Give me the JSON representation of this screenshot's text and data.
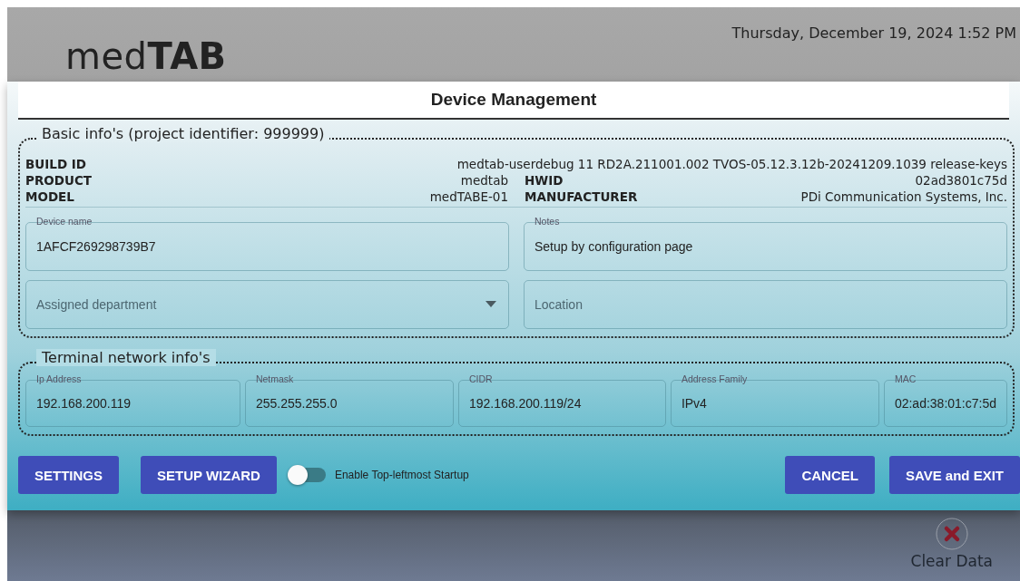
{
  "header": {
    "logo": {
      "light": "med",
      "bold": "TAB"
    },
    "datetime": "Thursday, December 19, 2024 1:52 PM"
  },
  "dialog": {
    "title": "Device Management",
    "basic_info": {
      "legend": "Basic info's (project identifier: 999999)",
      "build": {
        "label": "BUILD ID",
        "value": "medtab-userdebug 11 RD2A.211001.002 TVOS-05.12.3.12b-20241209.1039 release-keys"
      },
      "pairs": [
        [
          {
            "label": "PRODUCT",
            "value": "medtab"
          },
          {
            "label": "HWID",
            "value": "02ad3801c75d"
          }
        ],
        [
          {
            "label": "MODEL",
            "value": "medTABE-01"
          },
          {
            "label": "MANUFACTURER",
            "value": "PDi Communication Systems, Inc."
          }
        ]
      ],
      "fields": [
        {
          "kind": "text",
          "label": "Device name",
          "value": "1AFCF269298739B7"
        },
        {
          "kind": "text",
          "label": "Notes",
          "value": "Setup by configuration page"
        },
        {
          "kind": "select",
          "placeholder": "Assigned department"
        },
        {
          "kind": "text",
          "placeholder": "Location"
        }
      ]
    },
    "network_info": {
      "legend": "Terminal network info's",
      "fields": [
        {
          "label": "Ip Address",
          "value": "192.168.200.119"
        },
        {
          "label": "Netmask",
          "value": "255.255.255.0"
        },
        {
          "label": "CIDR",
          "value": "192.168.200.119/24"
        },
        {
          "label": "Address Family",
          "value": "IPv4"
        },
        {
          "label": "MAC",
          "value": "02:ad:38:01:c7:5d"
        }
      ]
    },
    "left_buttons": [
      "SETTINGS",
      "SETUP WIZARD"
    ],
    "toggle": {
      "label": "Enable Top-leftmost Startup",
      "on": false
    },
    "right_buttons": [
      "CANCEL",
      "SAVE and EXIT"
    ]
  },
  "clear_data": {
    "label": "Clear Data"
  }
}
